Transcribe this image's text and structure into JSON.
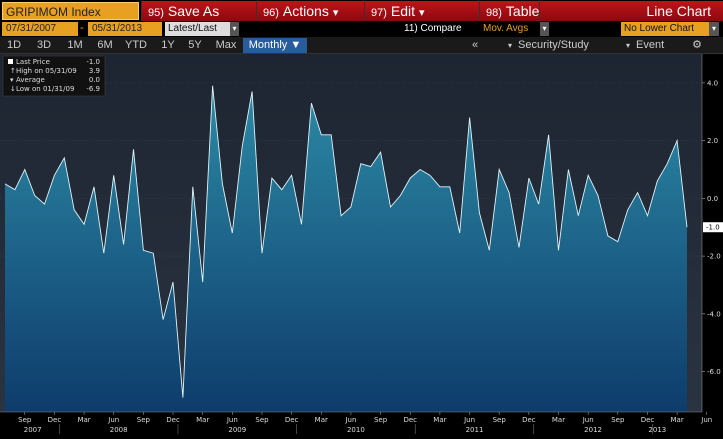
{
  "toolbar": {
    "ticker": "GRIPIMOM Index",
    "save_num": "95)",
    "save_label": "Save As",
    "actions_num": "96)",
    "actions_label": "Actions",
    "edit_num": "97)",
    "edit_label": "Edit",
    "table_num": "98)",
    "table_label": "Table",
    "chart_type": "Line Chart",
    "chevron": "▾"
  },
  "daterow": {
    "start": "07/31/2007",
    "dash": "-",
    "end": "05/31/2013",
    "latest": "Latest/Last",
    "compare": "11) Compare",
    "mov_avgs": "Mov. Avgs",
    "lower_chart": "No Lower Chart",
    "drop": "▾"
  },
  "periods": [
    "1D",
    "3D",
    "1M",
    "6M",
    "YTD",
    "1Y",
    "5Y",
    "Max"
  ],
  "frequency": "Monthly ▼",
  "right_tabs": {
    "collapse": "«",
    "security": "Security/Study",
    "event": "Event",
    "gear": "⚙"
  },
  "legend": {
    "rows": [
      {
        "label": "Last Price",
        "value": "-1.0"
      },
      {
        "label": "High on 05/31/09",
        "value": "3.9"
      },
      {
        "label": "Average",
        "value": "0.0"
      },
      {
        "label": "Low on 01/31/09",
        "value": "-6.9"
      }
    ]
  },
  "colors": {
    "area_top": "#2c8aa6",
    "area_bottom": "#0e3c6b",
    "bg_top": "#1e2532",
    "bg_bottom": "#2a3340",
    "line": "#dff4f8",
    "last_badge": "#ffffff"
  },
  "chart_data": {
    "type": "area",
    "x_start": "2007-07",
    "x_end": "2013-06",
    "frequency": "monthly",
    "ylim": [
      -7.4,
      5.0
    ],
    "yticks": [
      4.0,
      2.0,
      0.0,
      -2.0,
      -4.0,
      -6.0
    ],
    "ytick_labels": [
      "4.0",
      "2.0",
      "0.0",
      "-2.0",
      "-4.0",
      "-6.0"
    ],
    "last_value_label": "-1.0",
    "month_ticks": [
      "Sep",
      "Dec",
      "Mar",
      "Jun",
      "Sep",
      "Dec",
      "Mar",
      "Jun",
      "Sep",
      "Dec",
      "Mar",
      "Jun",
      "Sep",
      "Dec",
      "Mar",
      "Jun",
      "Sep",
      "Dec",
      "Mar",
      "Jun",
      "Sep",
      "Dec",
      "Mar",
      "Jun"
    ],
    "year_labels": [
      "2007",
      "2008",
      "2009",
      "2010",
      "2011",
      "2012",
      "2013"
    ],
    "values": [
      0.5,
      0.3,
      1.0,
      0.1,
      -0.2,
      0.8,
      1.4,
      -0.4,
      -0.9,
      0.4,
      -1.9,
      0.8,
      -1.6,
      1.7,
      -1.8,
      -1.9,
      -4.2,
      -2.9,
      -6.9,
      0.4,
      -2.9,
      3.9,
      0.5,
      -1.2,
      1.8,
      3.7,
      -1.9,
      0.7,
      0.3,
      0.8,
      -0.9,
      3.3,
      2.2,
      2.2,
      -0.6,
      -0.3,
      1.2,
      1.1,
      1.6,
      -0.3,
      0.1,
      0.7,
      1.0,
      0.8,
      0.4,
      0.4,
      -1.2,
      2.8,
      -0.5,
      -1.8,
      1.0,
      0.2,
      -1.7,
      0.7,
      -0.2,
      2.2,
      -1.8,
      1.0,
      -0.6,
      0.8,
      0.1,
      -1.3,
      -1.5,
      -0.4,
      0.2,
      -0.6,
      0.6,
      1.2,
      2.0,
      -1.0
    ]
  }
}
